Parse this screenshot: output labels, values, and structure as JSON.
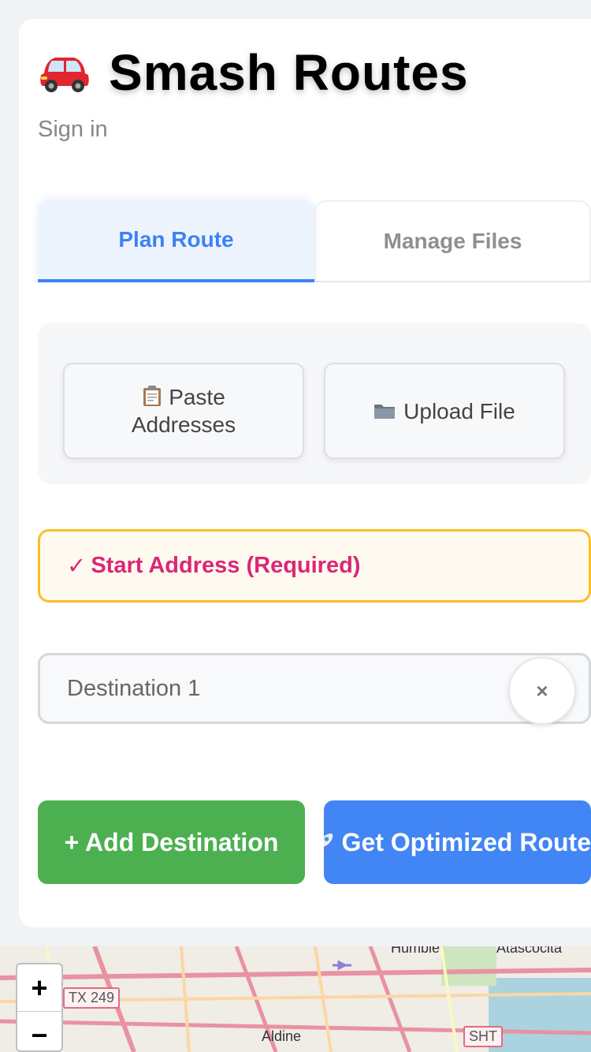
{
  "app": {
    "title": "Smash Routes",
    "signin_label": "Sign in"
  },
  "tabs": [
    {
      "label": "Plan Route",
      "active": true
    },
    {
      "label": "Manage Files",
      "active": false
    }
  ],
  "import": {
    "paste_icon": "clipboard-icon",
    "paste_label_line1": "Paste",
    "paste_label_line2": "Addresses",
    "upload_icon": "folder-icon",
    "upload_label": "Upload File"
  },
  "start_address": {
    "check": "✓",
    "label": "Start Address (Required)"
  },
  "destinations": [
    {
      "placeholder": "Destination 1",
      "clear_label": "×"
    }
  ],
  "actions": {
    "add_label": "+ Add Destination",
    "optimize_icon": "rocket-icon",
    "optimize_label": "Get Optimized Route"
  },
  "map": {
    "zoom_in": "+",
    "zoom_out": "−",
    "labels": {
      "humble": "Humble",
      "atascocita": "Atascocita",
      "aldine": "Aldine"
    },
    "shields": {
      "tx249": "TX 249",
      "sht": "SHT"
    }
  },
  "colors": {
    "accent": "#3b82f6",
    "start_text": "#db2777",
    "start_border": "#fbbf24",
    "add_button": "#4cb050",
    "optimize_button": "#4285f4"
  }
}
